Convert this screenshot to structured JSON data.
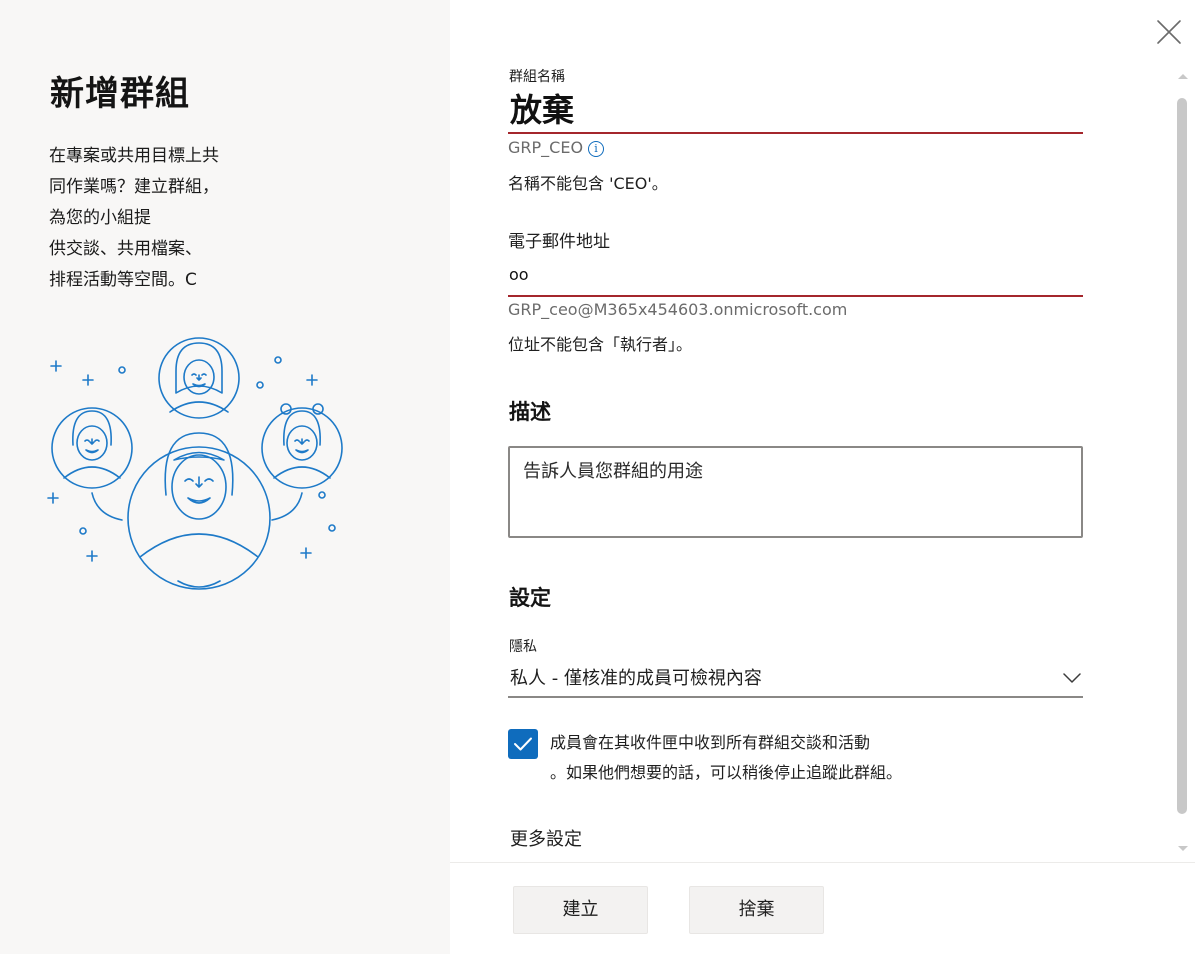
{
  "left": {
    "title": "新增群組",
    "desc_lines": [
      "在專案或共用目標上共",
      "同作業嗎？建立群組，",
      "為您的小組提",
      "供交談、共用檔案、",
      "排程活動等空間。C"
    ]
  },
  "form": {
    "name_label": "群組名稱",
    "name_value": "放棄",
    "name_alias": "GRP_CEO",
    "name_error": "名稱不能包含 'CEO'。",
    "email_label": "電子郵件地址",
    "email_value": "oo",
    "email_full": "GRP_ceo@M365x454603.onmicrosoft.com",
    "email_error": "位址不能包含「執行者」。",
    "desc_heading": "描述",
    "desc_placeholder": "告訴人員您群組的用途",
    "settings_heading": "設定",
    "privacy_label": "隱私",
    "privacy_value": "私人 - 僅核准的成員可檢視內容",
    "subscribe_checked": true,
    "subscribe_lines": [
      "成員會在其收件匣中收到所有群組交談和活動",
      "。如果他們想要的話，可以稍後停止追蹤此群組。"
    ],
    "more_settings": "更多設定"
  },
  "footer": {
    "create_label": "建立",
    "discard_label": "捨棄"
  },
  "colors": {
    "accent": "#0f6cbd",
    "error_underline": "#a4262c",
    "left_bg": "#f8f7f6"
  },
  "icons": {
    "close": "close-icon",
    "info": "info-icon",
    "chevron": "chevron-down-icon",
    "check": "checkmark-icon"
  }
}
